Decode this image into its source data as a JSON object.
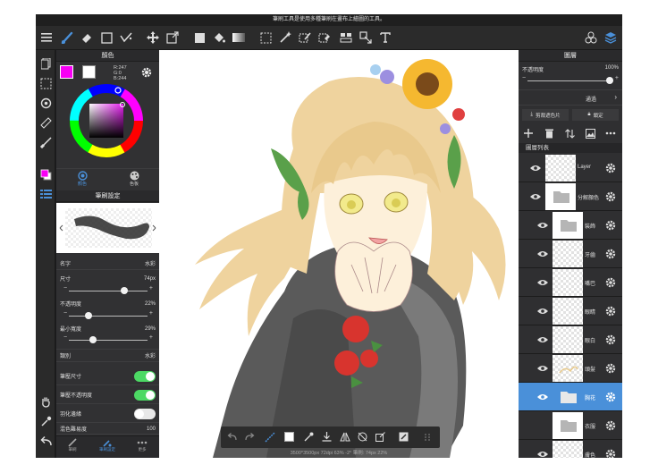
{
  "status_bar": {
    "text": "筆刷工具是使用多種筆刷在畫布上繪圖的工具。"
  },
  "color_panel": {
    "title": "顏色",
    "rgb": {
      "r": "R:247",
      "g": "G:0",
      "b": "B:244"
    },
    "tabs": [
      {
        "label": "顏色"
      },
      {
        "label": "色板"
      }
    ]
  },
  "brush_panel": {
    "title": "筆刷設定",
    "name_label": "名字",
    "name_value": "水彩",
    "size_label": "尺寸",
    "size_value": "74px",
    "opacity_label": "不透明度",
    "opacity_value": "22%",
    "minwidth_label": "最小寬度",
    "minwidth_value": "29%",
    "type_label": "類別",
    "type_value": "水彩",
    "pressure_size_label": "筆壓尺寸",
    "pressure_opacity_label": "筆壓不透明度",
    "feather_label": "羽化邊緣",
    "mix_label": "混色難易度",
    "mix_value": "100",
    "bottom_tabs": [
      {
        "label": "筆刷"
      },
      {
        "label": "筆刷設定"
      },
      {
        "label": "更多"
      }
    ]
  },
  "sliders": {
    "size": 0.73,
    "opacity": 0.22,
    "minwidth": 0.29
  },
  "toggles": {
    "pressure_size": true,
    "pressure_opacity": true,
    "feather": false
  },
  "layer_panel": {
    "title": "圖層",
    "opacity_label": "不透明度",
    "opacity_value": "100%",
    "blend_mode": "通過",
    "clip_label": "剪裁遮色片",
    "lock_label": "鎖定",
    "list_title": "圖層列表",
    "layers": [
      {
        "name": "Layer"
      },
      {
        "name": "分解顏色"
      },
      {
        "name": "裝飾"
      },
      {
        "name": "牙齒"
      },
      {
        "name": "嘴巴"
      },
      {
        "name": "眼睛"
      },
      {
        "name": "眼白"
      },
      {
        "name": "頭髮"
      },
      {
        "name": "胸花"
      },
      {
        "name": "衣服"
      },
      {
        "name": "膚色"
      }
    ]
  },
  "canvas_info": "3500*3500px 72dpi 63% -2° 筆刷: 74px 22%",
  "colors": {
    "primary": "#f700f4",
    "secondary": "#ffffff",
    "accent": "#4a90d9",
    "toggle_on": "#4cd964"
  },
  "icons": [
    "menu-icon",
    "brush-icon",
    "eraser-icon",
    "select-rect-icon",
    "magic-icon",
    "move-icon",
    "transform-icon",
    "fill-rect-icon",
    "bucket-icon",
    "gradient-icon",
    "marquee-icon",
    "wand-icon",
    "select-pen-icon",
    "eraser-select-icon",
    "layer-cut-icon",
    "pen-tool-icon",
    "text-icon",
    "materials-icon",
    "layers-icon"
  ]
}
